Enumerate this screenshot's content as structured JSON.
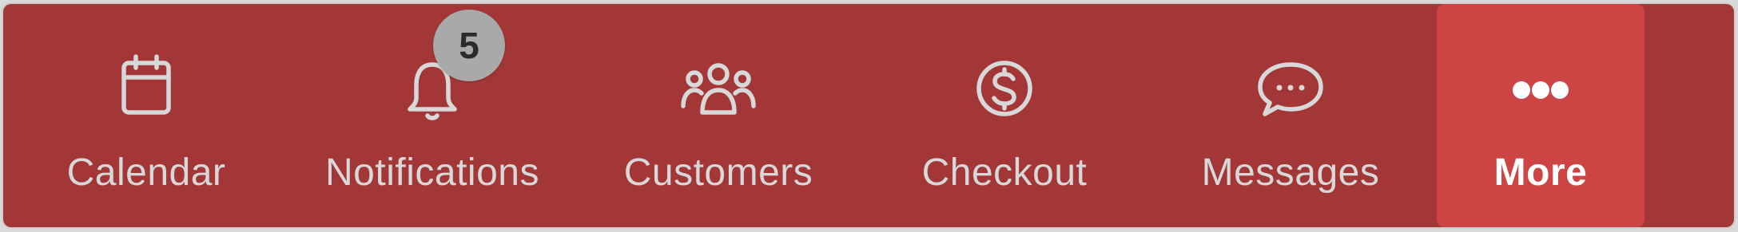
{
  "tabbar": {
    "tabs": [
      {
        "label": "Calendar",
        "icon": "calendar-icon"
      },
      {
        "label": "Notifications",
        "icon": "bell-icon",
        "badge": "5"
      },
      {
        "label": "Customers",
        "icon": "people-icon"
      },
      {
        "label": "Checkout",
        "icon": "dollar-circle-icon"
      },
      {
        "label": "Messages",
        "icon": "chat-bubble-icon"
      },
      {
        "label": "More",
        "icon": "more-dots-icon",
        "active": true
      }
    ]
  },
  "colors": {
    "bar_background": "#a33636",
    "active_tab_background": "#cc4444",
    "inactive_text": "#d8d8d8",
    "active_text": "#ffffff",
    "badge_background": "#a9a9a9",
    "badge_text": "#2b2b2b"
  }
}
